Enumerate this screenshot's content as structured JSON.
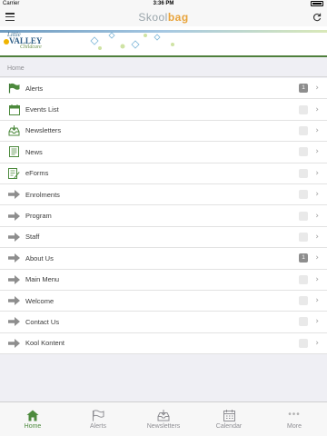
{
  "status_bar": {
    "carrier": "Carrier",
    "time": "3:36 PM"
  },
  "navbar": {
    "logo_part1": "Skool",
    "logo_part2": "bag"
  },
  "banner": {
    "little": "Little",
    "valley": "VALLEY",
    "childcare": "Childcare"
  },
  "breadcrumb": "Home",
  "menu": [
    {
      "label": "Alerts",
      "badge": "1",
      "icon": "flag-icon"
    },
    {
      "label": "Events List",
      "badge": "",
      "icon": "calendar-icon"
    },
    {
      "label": "Newsletters",
      "badge": "",
      "icon": "inbox-icon"
    },
    {
      "label": "News",
      "badge": "",
      "icon": "news-icon"
    },
    {
      "label": "eForms",
      "badge": "",
      "icon": "form-icon"
    },
    {
      "label": "Enrolments",
      "badge": "",
      "icon": "arrow-right-icon"
    },
    {
      "label": "Program",
      "badge": "",
      "icon": "arrow-right-icon"
    },
    {
      "label": "Staff",
      "badge": "",
      "icon": "arrow-right-icon"
    },
    {
      "label": "About Us",
      "badge": "1",
      "icon": "arrow-right-icon"
    },
    {
      "label": "Main Menu",
      "badge": "",
      "icon": "arrow-right-icon"
    },
    {
      "label": "Welcome",
      "badge": "",
      "icon": "arrow-right-icon"
    },
    {
      "label": "Contact Us",
      "badge": "",
      "icon": "arrow-right-icon"
    },
    {
      "label": "Kool Kontent",
      "badge": "",
      "icon": "arrow-right-icon"
    }
  ],
  "tabs": [
    {
      "label": "Home",
      "icon": "home-icon",
      "active": true
    },
    {
      "label": "Alerts",
      "icon": "flag-icon",
      "active": false
    },
    {
      "label": "Newsletters",
      "icon": "inbox-icon",
      "active": false
    },
    {
      "label": "Calendar",
      "icon": "calendar-icon",
      "active": false
    },
    {
      "label": "More",
      "icon": "more-dots-icon",
      "active": false
    }
  ],
  "colors": {
    "accent_green": "#4d8a3d",
    "badge_filled": "#8e8e8e",
    "banner_border": "#4f7f3c"
  }
}
